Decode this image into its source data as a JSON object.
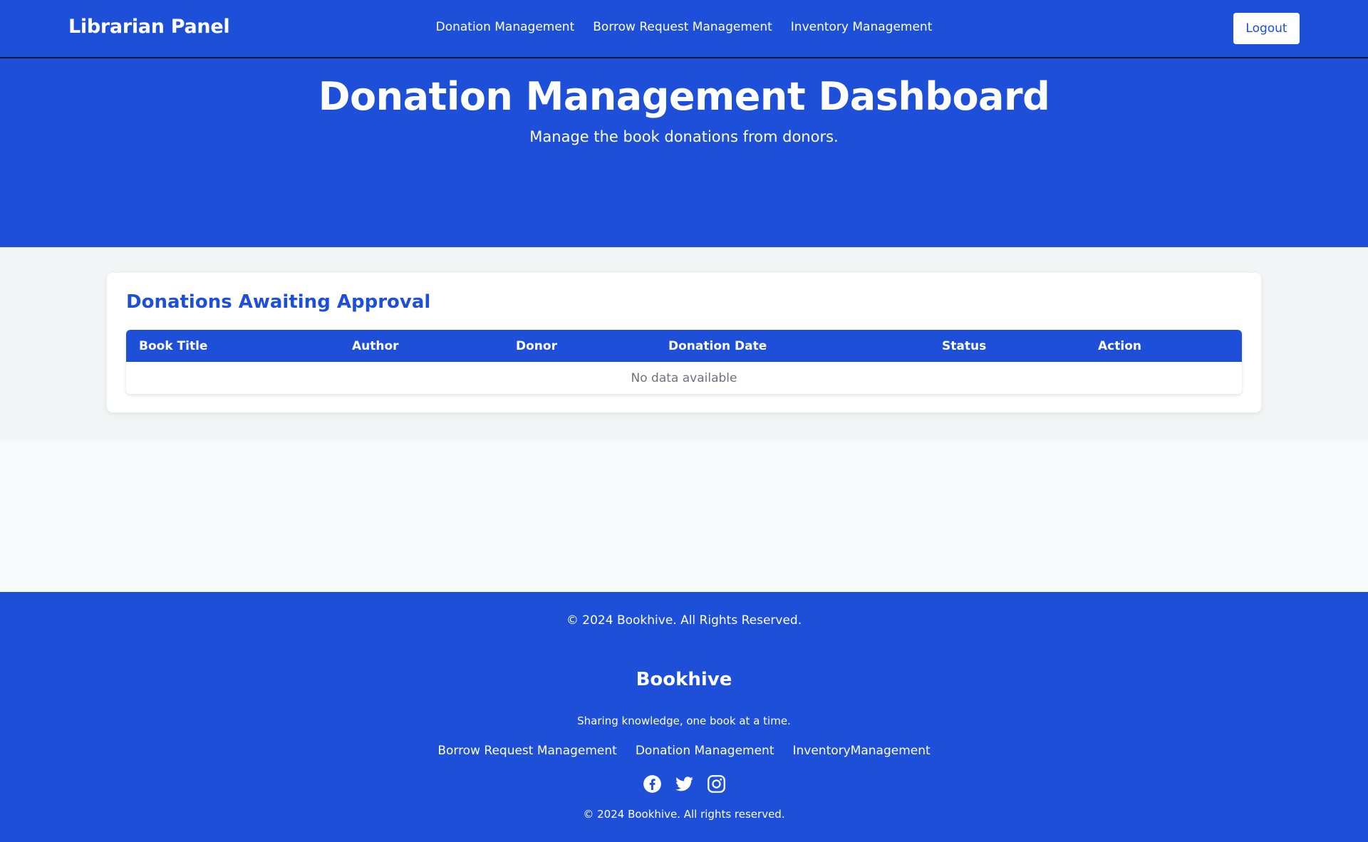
{
  "navbar": {
    "brand": "Librarian Panel",
    "links": [
      "Donation Management",
      "Borrow Request Management",
      "Inventory Management"
    ],
    "logout_label": "Logout"
  },
  "hero": {
    "title": "Donation Management Dashboard",
    "subtitle": "Manage the book donations from donors."
  },
  "card": {
    "title": "Donations Awaiting Approval",
    "columns": [
      "Book Title",
      "Author",
      "Donor",
      "Donation Date",
      "Status",
      "Action"
    ],
    "empty_text": "No data available"
  },
  "footer": {
    "copyright_top": "© 2024 Bookhive. All Rights Reserved.",
    "brand": "Bookhive",
    "tagline": "Sharing knowledge, one book at a time.",
    "links": [
      "Borrow Request Management",
      "Donation Management",
      "InventoryManagement"
    ],
    "social_icons": [
      "facebook-icon",
      "twitter-icon",
      "instagram-icon"
    ],
    "copyright_bottom": "© 2024 Bookhive. All rights reserved."
  },
  "colors": {
    "primary": "#1d4fd8",
    "main_bg": "#f3f4f6",
    "card_bg": "#ffffff"
  }
}
